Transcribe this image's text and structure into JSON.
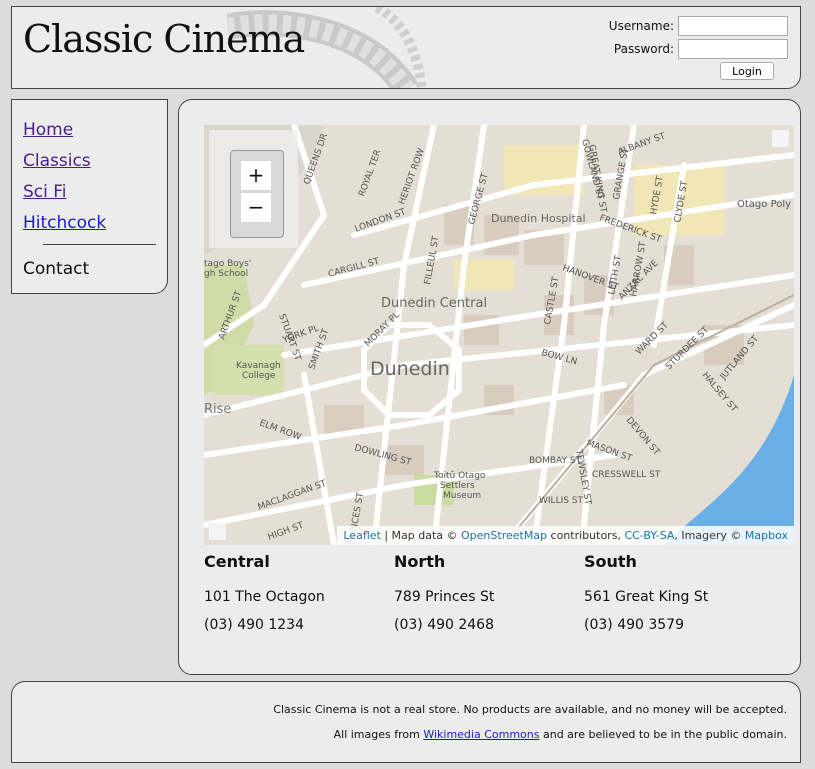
{
  "header": {
    "logo_text": "Classic Cinema",
    "login": {
      "username_label": "Username:",
      "username_value": "",
      "password_label": "Password:",
      "password_value": "",
      "button_label": "Login"
    }
  },
  "nav": {
    "items": [
      "Home",
      "Classics",
      "Sci Fi",
      "Hitchcock"
    ],
    "contact": "Contact"
  },
  "map": {
    "zoom_in": "+",
    "zoom_out": "−",
    "labels": {
      "central": "Dunedin Central",
      "city": "Dunedin",
      "hospital": "Dunedin Hospital",
      "boys_high": "Otago Boys' High School",
      "kavanagh": "Kavanagh College",
      "rise": "Rise",
      "toitu": "Toitū Otago Settlers Museum",
      "otago_poly": "Otago Poly",
      "streets": [
        "ALBANY ST",
        "FREDERICK ST",
        "HANOVER ST",
        "GEORGE ST",
        "FILLEUL ST",
        "LONDON ST",
        "CARGILL ST",
        "STUART ST",
        "YORK PL",
        "ARTHUR ST",
        "SMITH ST",
        "MORAY PL",
        "ELM ROW",
        "DOWLING ST",
        "BOW LN",
        "CASTLE ST",
        "GREAT KING ST",
        "ANZAC AVE",
        "WARD ST",
        "STURDEE ST",
        "HALSEY ST",
        "JUTLAND ST",
        "DEVON ST",
        "MASON ST",
        "BOMBAY ST",
        "CRESSWELL ST",
        "WILLIS ST",
        "MACLAGGAN ST",
        "HIGH ST",
        "PRINCES ST",
        "TEWSLEY ST",
        "QUEENS DR",
        "ROYAL TER",
        "HERIOT ROW",
        "GOWLAND ST",
        "GRANGE ST",
        "HYDE ST",
        "CLYDE ST",
        "LEITH ST",
        "HARROW ST"
      ]
    },
    "attribution": {
      "leaflet": "Leaflet",
      "sep1": " | Map data © ",
      "osm": "OpenStreetMap",
      "sep2": " contributors, ",
      "license": "CC-BY-SA",
      "sep3": ", Imagery © ",
      "mapbox": "Mapbox"
    }
  },
  "stores": [
    {
      "name": "Central",
      "address": "101 The Octagon",
      "phone": "(03) 490 1234"
    },
    {
      "name": "North",
      "address": "789 Princes St",
      "phone": "(03) 490 2468"
    },
    {
      "name": "South",
      "address": "561 Great King St",
      "phone": "(03) 490 3579"
    }
  ],
  "footer": {
    "line1": "Classic Cinema is not a real store. No products are available, and no money will be accepted.",
    "line2_prefix": "All images from ",
    "line2_link": "Wikimedia Commons",
    "line2_suffix": " and are believed to be in the public domain."
  },
  "colors": {
    "water": "#6ab0e6",
    "park": "#c9dca0",
    "campus": "#f0e3a8",
    "block": "#ddd3c6",
    "road": "#ffffff"
  }
}
